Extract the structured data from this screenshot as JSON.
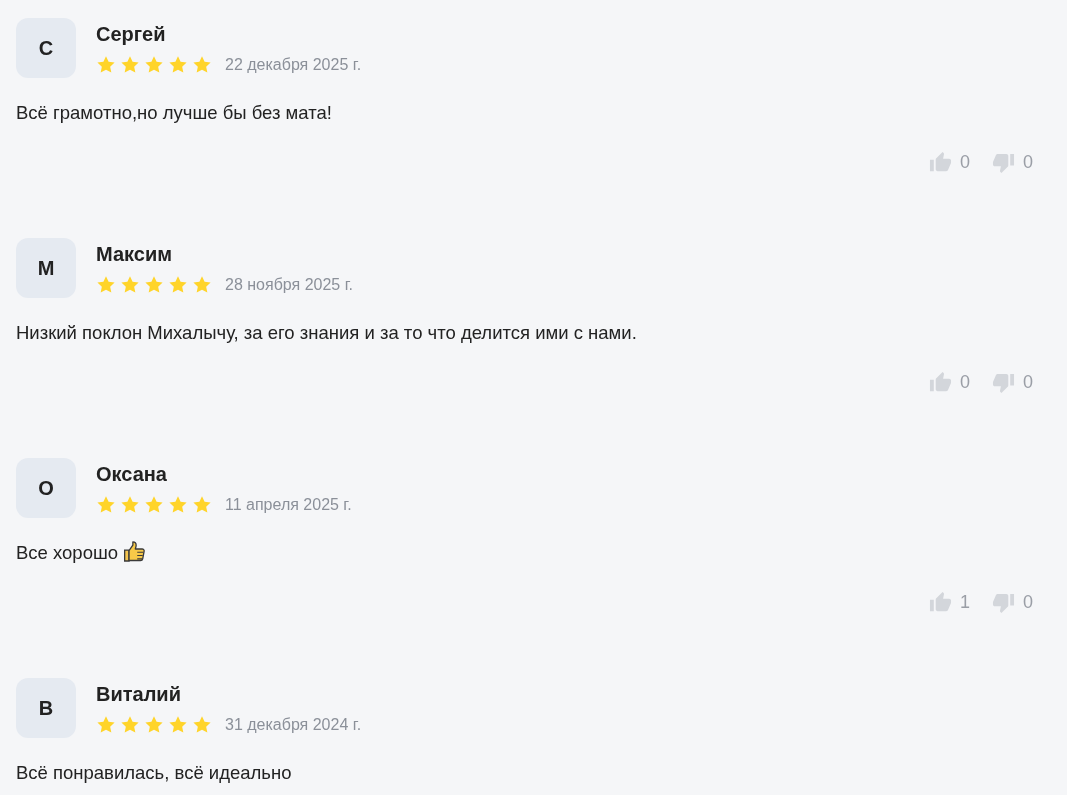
{
  "reviews": [
    {
      "initial": "С",
      "author": "Сергей",
      "stars": 5,
      "date": "22 декабря 2025 г.",
      "text": "Всё грамотно,но лучше бы без мата!",
      "likes": "0",
      "dislikes": "0"
    },
    {
      "initial": "М",
      "author": "Максим",
      "stars": 5,
      "date": "28 ноября 2025 г.",
      "text": "Низкий поклон Михалычу, за его знания и за то что делится ими с нами.",
      "likes": "0",
      "dislikes": "0"
    },
    {
      "initial": "О",
      "author": "Оксана",
      "stars": 5,
      "date": "11 апреля 2025 г.",
      "text": "Все хорошо",
      "ends_with_emoji": true,
      "likes": "1",
      "dislikes": "0"
    },
    {
      "initial": "В",
      "author": "Виталий",
      "stars": 5,
      "date": "31 декабря 2024 г.",
      "text": "Всё понравилась, всё идеально"
    }
  ]
}
